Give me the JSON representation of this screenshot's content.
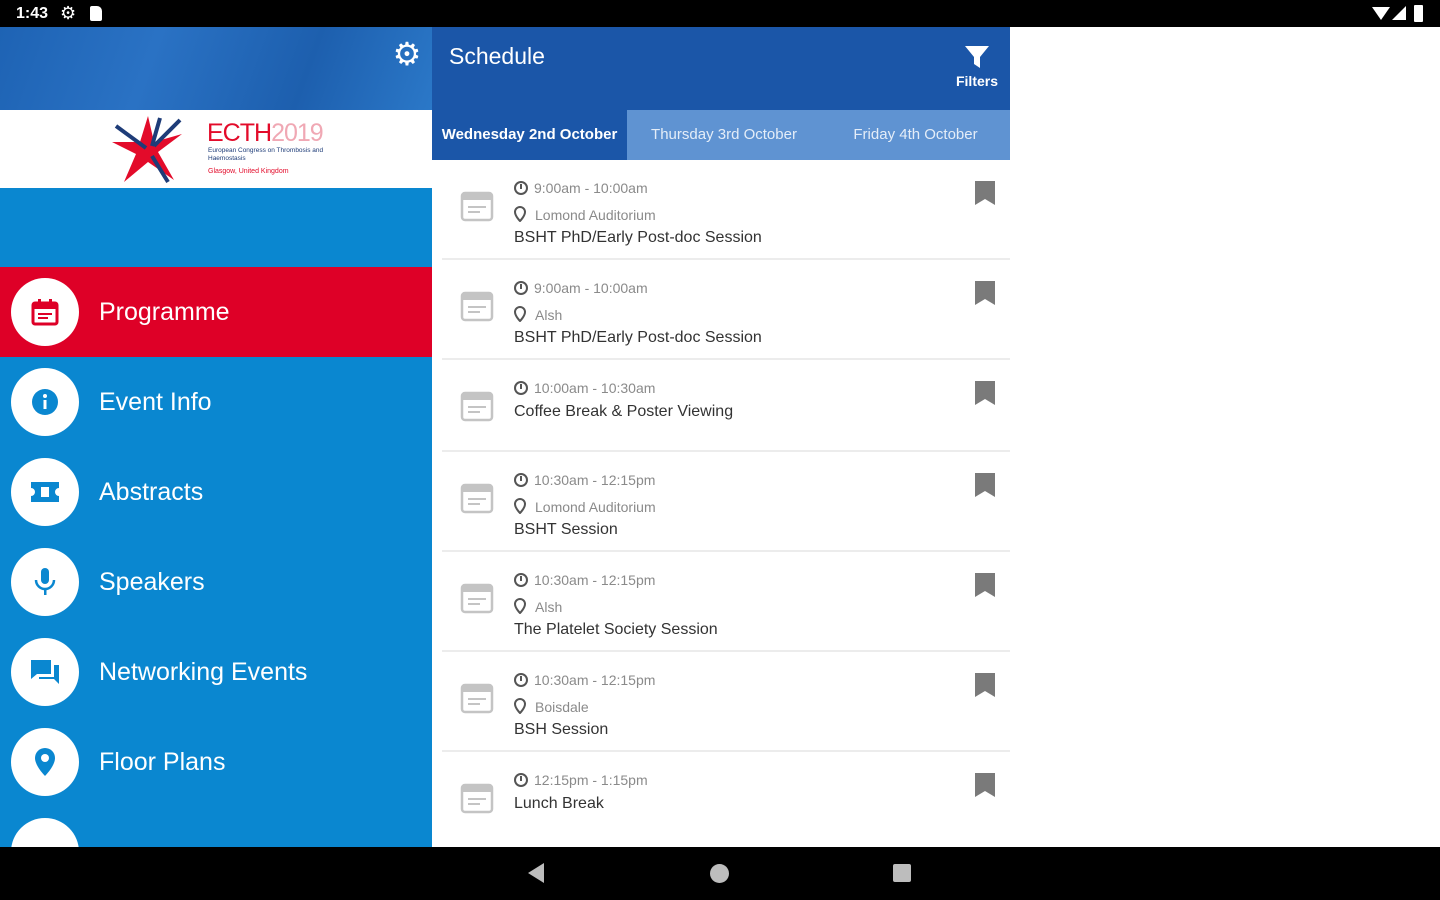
{
  "status_bar": {
    "time": "1:43"
  },
  "drawer": {
    "logo": {
      "title": "ECTH",
      "year": "2019",
      "subtitle": "European Congress on Thrombosis and Haemostasis",
      "location": "Glasgow, United Kingdom"
    },
    "items": [
      {
        "label": "Programme",
        "icon": "calendar-icon",
        "active": true
      },
      {
        "label": "Event Info",
        "icon": "info-icon",
        "active": false
      },
      {
        "label": "Abstracts",
        "icon": "ticket-icon",
        "active": false
      },
      {
        "label": "Speakers",
        "icon": "microphone-icon",
        "active": false
      },
      {
        "label": "Networking Events",
        "icon": "chat-icon",
        "active": false
      },
      {
        "label": "Floor Plans",
        "icon": "map-pin-icon",
        "active": false
      }
    ]
  },
  "header": {
    "title": "Schedule",
    "filters_label": "Filters"
  },
  "tabs": [
    {
      "label": "Wednesday 2nd October",
      "active": true
    },
    {
      "label": "Thursday 3rd October",
      "active": false
    },
    {
      "label": "Friday 4th October",
      "active": false
    }
  ],
  "sessions": [
    {
      "time": "9:00am - 10:00am",
      "location": "Lomond Auditorium",
      "title": "BSHT PhD/Early Post-doc Session"
    },
    {
      "time": "9:00am - 10:00am",
      "location": "Alsh",
      "title": "BSHT PhD/Early Post-doc Session"
    },
    {
      "time": "10:00am - 10:30am",
      "location": "",
      "title": "Coffee Break & Poster Viewing"
    },
    {
      "time": "10:30am - 12:15pm",
      "location": "Lomond Auditorium",
      "title": "BSHT Session"
    },
    {
      "time": "10:30am - 12:15pm",
      "location": "Alsh",
      "title": "The Platelet Society Session"
    },
    {
      "time": "10:30am - 12:15pm",
      "location": "Boisdale",
      "title": "BSH Session"
    },
    {
      "time": "12:15pm - 1:15pm",
      "location": "",
      "title": "Lunch Break"
    }
  ],
  "colors": {
    "drawer_blue": "#0a87d0",
    "header_blue": "#1b56a8",
    "tab_strip": "#5f93d2",
    "active_red": "#de0027"
  }
}
